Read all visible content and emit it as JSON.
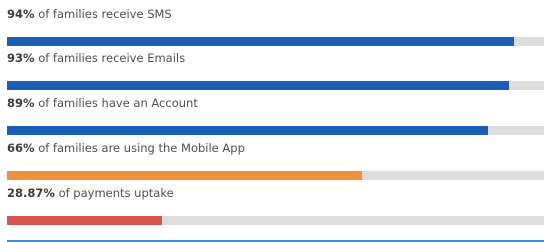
{
  "stats": [
    {
      "value": "94%",
      "label": "of families receive SMS",
      "fraction": 0.944,
      "color": "#1a5fb4"
    },
    {
      "value": "93%",
      "label": "of families receive Emails",
      "fraction": 0.935,
      "color": "#1a5fb4"
    },
    {
      "value": "89%",
      "label": "of families have an Account",
      "fraction": 0.895,
      "color": "#1a5fb4"
    },
    {
      "value": "66%",
      "label": "of families are using the Mobile App",
      "fraction": 0.662,
      "color": "#f0913a"
    },
    {
      "value": "28.87%",
      "label": "of payments uptake",
      "fraction": 0.288,
      "color": "#d9534f"
    }
  ],
  "colors": {
    "track": "#dddddd",
    "bottom_rule": "#3a8fd6"
  }
}
